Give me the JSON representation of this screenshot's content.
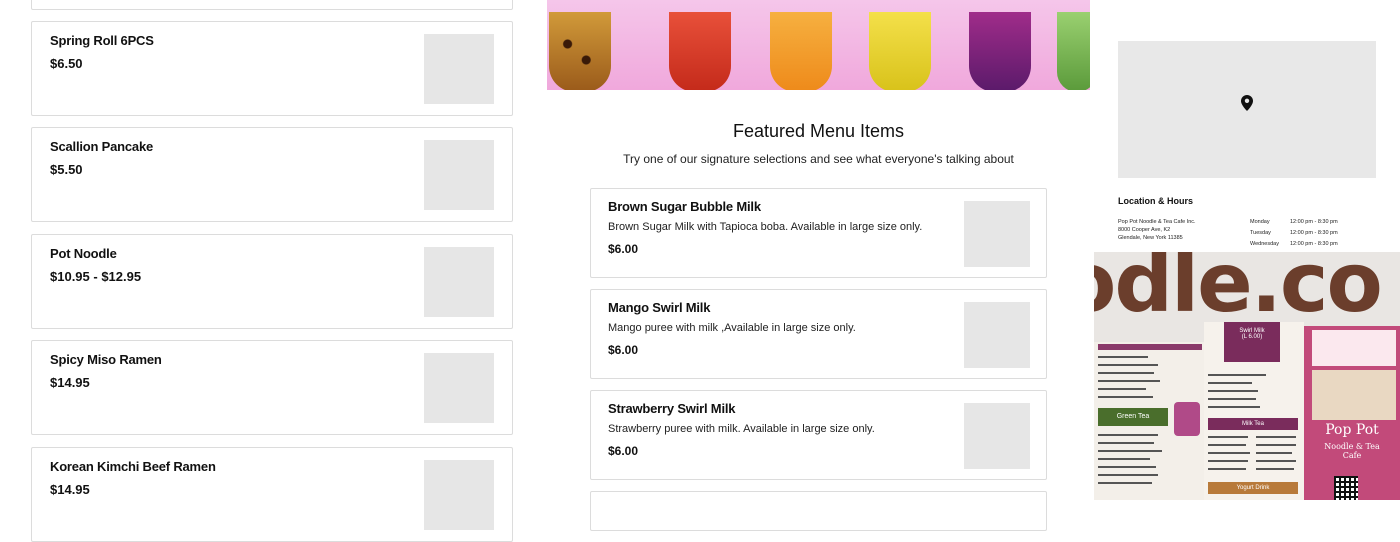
{
  "left_menu": {
    "items": [
      {
        "name": "Spring Roll 6PCS",
        "price": "$6.50"
      },
      {
        "name": "Scallion Pancake",
        "price": "$5.50"
      },
      {
        "name": "Pot Noodle",
        "price": "$10.95 - $12.95"
      },
      {
        "name": "Spicy Miso Ramen",
        "price": "$14.95"
      },
      {
        "name": "Korean Kimchi Beef Ramen",
        "price": "$14.95"
      }
    ]
  },
  "featured": {
    "title": "Featured Menu Items",
    "subtitle": "Try one of our signature selections and see what everyone's talking about",
    "items": [
      {
        "name": "Brown Sugar Bubble Milk",
        "desc": "Brown Sugar Milk with Tapioca boba. Available in large size only.",
        "price": "$6.00"
      },
      {
        "name": "Mango Swirl Milk",
        "desc": "Mango puree with milk ,Available in large size only.",
        "price": "$6.00"
      },
      {
        "name": "Strawberry Swirl Milk",
        "desc": "Strawberry puree with milk. Available in large size only.",
        "price": "$6.00"
      }
    ]
  },
  "location": {
    "heading": "Location & Hours",
    "address_lines": [
      "Pop Pot Noodle & Tea Cafe Inc.",
      "8000 Cooper Ave, K2",
      "Glendale, New York 11385"
    ],
    "hours": [
      {
        "day": "Monday",
        "time": "12:00 pm - 8:30 pm"
      },
      {
        "day": "Tuesday",
        "time": "12:00 pm - 8:30 pm"
      },
      {
        "day": "Wednesday",
        "time": "12:00 pm - 8:30 pm"
      }
    ],
    "map_pin_icon": "map-pin-icon"
  },
  "photo": {
    "sign_text": "odle.co",
    "store_sign_title": "Pop Pot",
    "store_sign_sub": "Noodle & Tea Cafe",
    "menu_board": {
      "swirl_heading": "Swirl Milk",
      "swirl_price": "(L 6.00)",
      "green_tea_heading": "Green Tea",
      "milk_tea_heading": "Milk Tea",
      "yogurt_heading": "Yogurt Drink"
    }
  },
  "colors": {
    "hero_bg": "#f0a8dc",
    "card_border": "#dcdcdc",
    "thumb": "#e6e6e6",
    "sign_brown": "#6b3e2c",
    "menu_purple": "#7a2c5c",
    "menu_green": "#4a6e2c"
  }
}
